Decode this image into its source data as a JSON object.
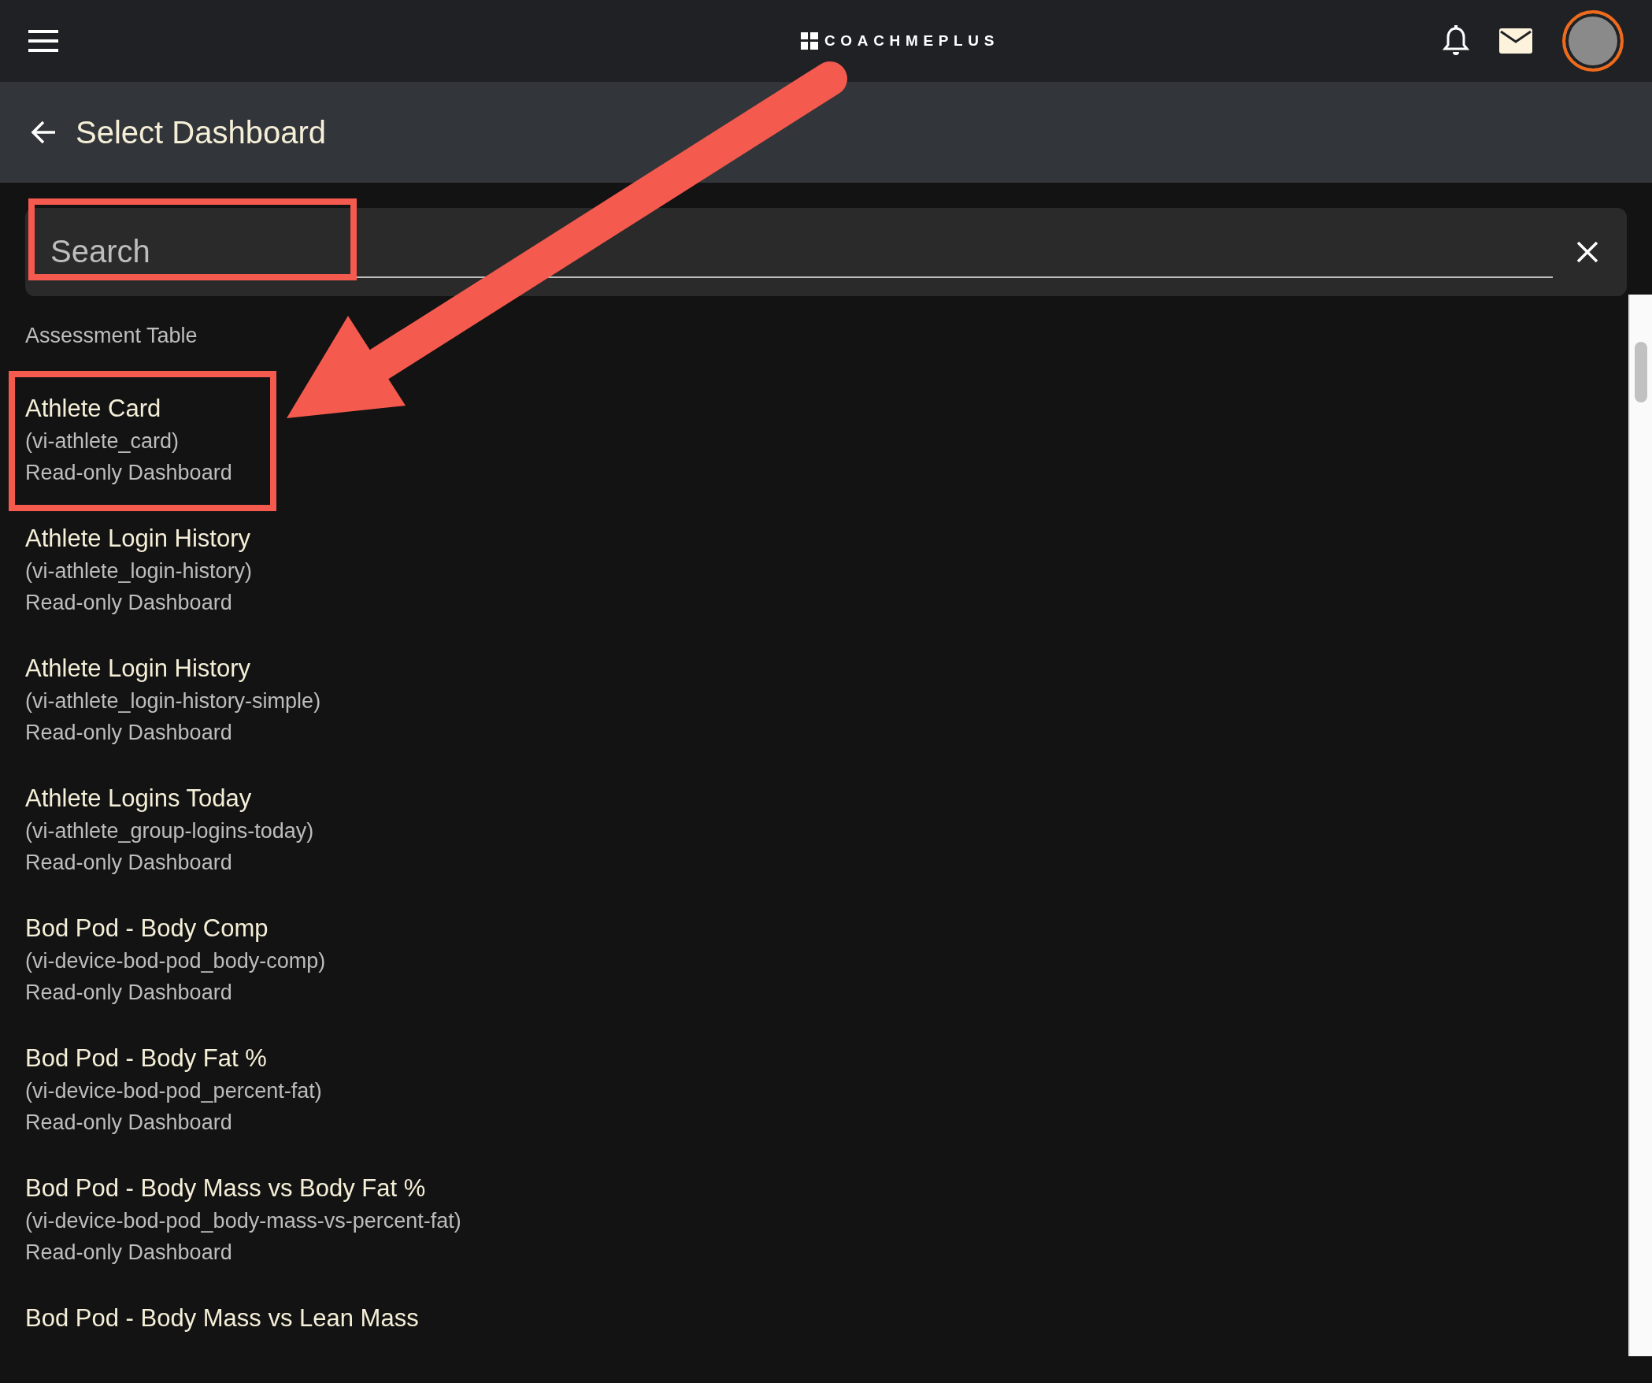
{
  "top_bar": {
    "logo_text": "COACHMEPLUS"
  },
  "header": {
    "title": "Select Dashboard"
  },
  "search": {
    "placeholder": "Search"
  },
  "section_label": "Assessment Table",
  "dashboards": [
    {
      "title": "Athlete Card",
      "slug": "(vi-athlete_card)",
      "type": "Read-only Dashboard"
    },
    {
      "title": "Athlete Login History",
      "slug": "(vi-athlete_login-history)",
      "type": "Read-only Dashboard"
    },
    {
      "title": "Athlete Login History",
      "slug": "(vi-athlete_login-history-simple)",
      "type": "Read-only Dashboard"
    },
    {
      "title": "Athlete Logins Today",
      "slug": "(vi-athlete_group-logins-today)",
      "type": "Read-only Dashboard"
    },
    {
      "title": "Bod Pod - Body Comp",
      "slug": "(vi-device-bod-pod_body-comp)",
      "type": "Read-only Dashboard"
    },
    {
      "title": "Bod Pod - Body Fat %",
      "slug": "(vi-device-bod-pod_percent-fat)",
      "type": "Read-only Dashboard"
    },
    {
      "title": "Bod Pod - Body Mass vs Body Fat %",
      "slug": "(vi-device-bod-pod_body-mass-vs-percent-fat)",
      "type": "Read-only Dashboard"
    },
    {
      "title": "Bod Pod - Body Mass vs Lean Mass"
    }
  ]
}
